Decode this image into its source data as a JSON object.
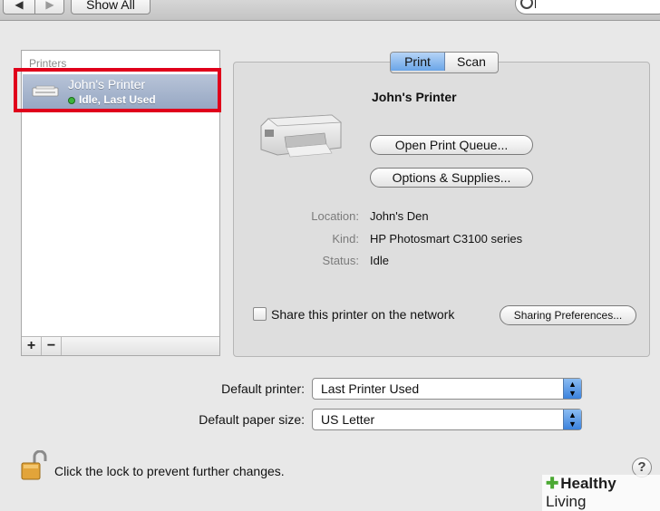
{
  "toolbar": {
    "back_icon": "back-arrow-icon",
    "forward_icon": "forward-arrow-icon",
    "show_all_label": "Show All",
    "search_value": ""
  },
  "printers_list": {
    "header": "Printers",
    "items": [
      {
        "name": "John's Printer",
        "status": "Idle, Last Used",
        "selected": true
      }
    ],
    "add_label": "+",
    "remove_label": "−"
  },
  "tabs": [
    {
      "label": "Print",
      "active": true
    },
    {
      "label": "Scan",
      "active": false
    }
  ],
  "detail": {
    "printer_name": "John's Printer",
    "open_queue_label": "Open Print Queue...",
    "options_label": "Options & Supplies...",
    "properties": [
      {
        "label": "Location:",
        "value": "John's Den"
      },
      {
        "label": "Kind:",
        "value": "HP Photosmart C3100 series"
      },
      {
        "label": "Status:",
        "value": "Idle"
      }
    ],
    "share_label": "Share this printer on the network",
    "share_checked": false,
    "sharing_prefs_label": "Sharing Preferences..."
  },
  "defaults": {
    "printer_label": "Default printer:",
    "printer_value": "Last Printer Used",
    "paper_label": "Default paper size:",
    "paper_value": "US Letter"
  },
  "footer": {
    "lock_text": "Click the lock to prevent further changes.",
    "help_label": "?",
    "watermark_bold": "Healthy",
    "watermark_light": "Living"
  },
  "colors": {
    "selection": "#95a6c2",
    "highlight_box": "#e0001b",
    "accent_blue": "#3b82dd"
  }
}
